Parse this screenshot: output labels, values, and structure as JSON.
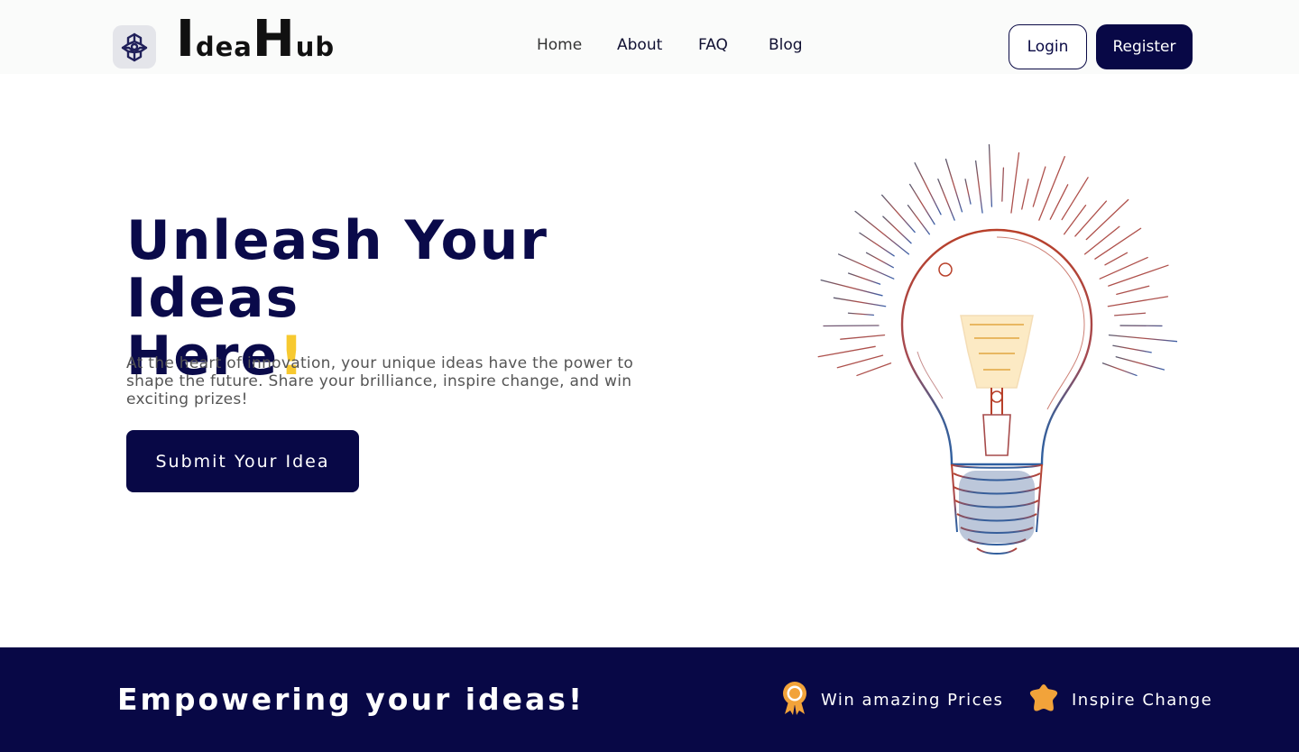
{
  "brand": {
    "logo_part1_cap": "I",
    "logo_part1_rest": "dea",
    "logo_part2_cap": "H",
    "logo_part2_rest": "ub"
  },
  "nav": {
    "items": [
      {
        "label": "Home"
      },
      {
        "label": "About"
      },
      {
        "label": "FAQ"
      },
      {
        "label": "Blog"
      }
    ]
  },
  "auth": {
    "login_label": "Login",
    "register_label": "Register"
  },
  "hero": {
    "title_line1": "Unleash Your Ideas",
    "title_line2": "Here",
    "title_accent": "!",
    "subtitle": "At the heart of innovation, your unique ideas have the power to shape the future. Share your brilliance, inspire change, and win exciting prizes!",
    "cta_label": "Submit Your Idea",
    "illustration": "lightbulb-sketch"
  },
  "band": {
    "title": "Empowering your ideas!",
    "features": [
      {
        "icon": "award-ribbon-icon",
        "label": "Win amazing Prices"
      },
      {
        "icon": "star-badge-icon",
        "label": "Inspire Change"
      }
    ]
  },
  "colors": {
    "navy": "#080846",
    "accent_yellow": "#f7c930",
    "icon_orange": "#f2a33a"
  }
}
